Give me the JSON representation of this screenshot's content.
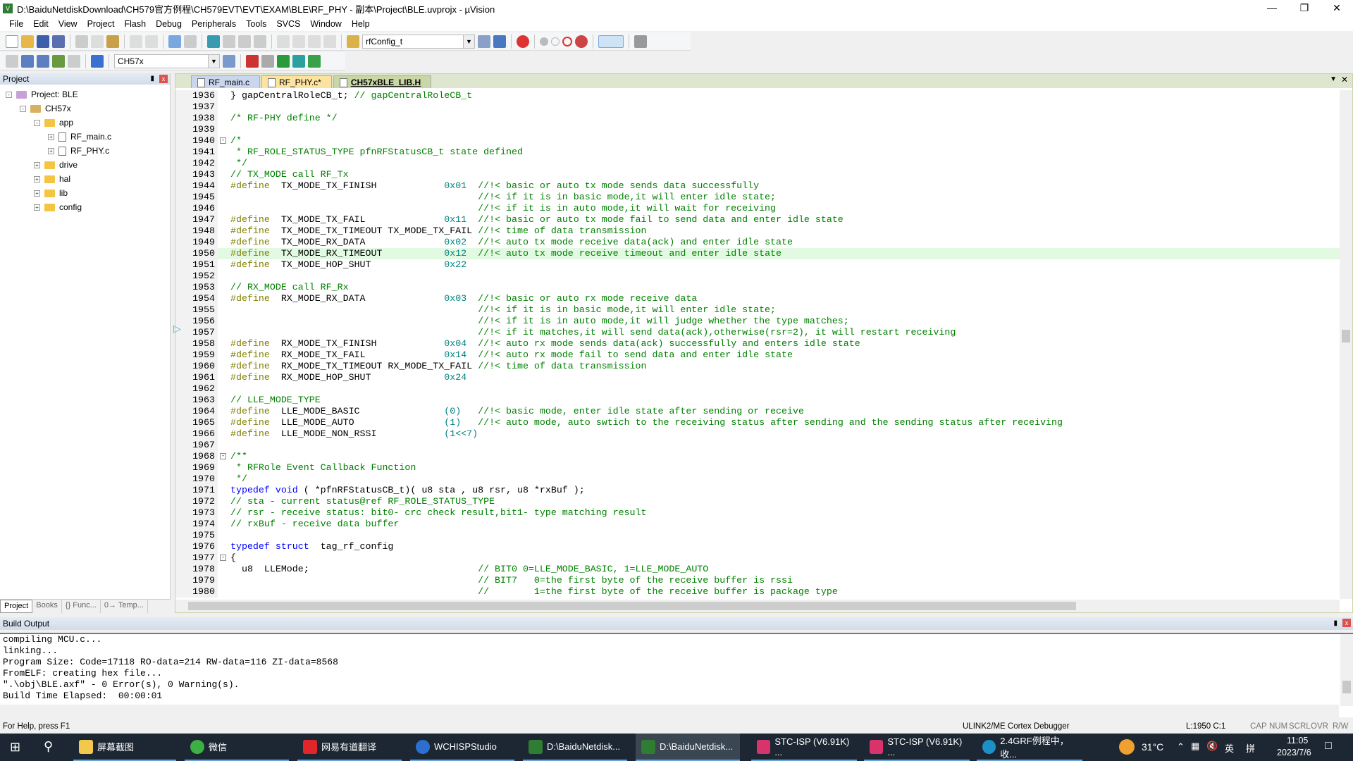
{
  "window": {
    "title": "D:\\BaiduNetdiskDownload\\CH579官方例程\\CH579EVT\\EVT\\EXAM\\BLE\\RF_PHY - 副本\\Project\\BLE.uvprojx - µVision",
    "app_icon": "V"
  },
  "menu": [
    "File",
    "Edit",
    "View",
    "Project",
    "Flash",
    "Debug",
    "Peripherals",
    "Tools",
    "SVCS",
    "Window",
    "Help"
  ],
  "toolbar": {
    "find_combo": "rfConfig_t",
    "target_combo": "CH57x"
  },
  "project_panel": {
    "title": "Project",
    "tree": [
      "Project: BLE",
      "CH57x",
      "app",
      "RF_main.c",
      "RF_PHY.c",
      "drive",
      "hal",
      "lib",
      "config"
    ],
    "tabs": [
      "Project",
      "Books",
      "{} Func...",
      "0→ Temp..."
    ]
  },
  "editor": {
    "tabs": [
      "RF_main.c",
      "RF_PHY.c*",
      "CH57xBLE_LIB.H"
    ],
    "active_tab": 2,
    "current_line": 1950,
    "lines": [
      {
        "n": 1936,
        "s": [
          [
            "t",
            "} gapCentralRoleCB_t; "
          ],
          [
            "c",
            "// gapCentralRoleCB_t"
          ]
        ]
      },
      {
        "n": 1937,
        "s": []
      },
      {
        "n": 1938,
        "s": [
          [
            "c",
            "/* RF-PHY define */"
          ]
        ]
      },
      {
        "n": 1939,
        "s": []
      },
      {
        "n": 1940,
        "f": true,
        "s": [
          [
            "c",
            "/*"
          ]
        ]
      },
      {
        "n": 1941,
        "s": [
          [
            "c",
            " * RF_ROLE_STATUS_TYPE pfnRFStatusCB_t state defined"
          ]
        ]
      },
      {
        "n": 1942,
        "s": [
          [
            "c",
            " */"
          ]
        ]
      },
      {
        "n": 1943,
        "s": [
          [
            "c",
            "// TX_MODE call RF_Tx"
          ]
        ]
      },
      {
        "n": 1944,
        "s": [
          [
            "p",
            "#define"
          ],
          [
            "t",
            "  TX_MODE_TX_FINISH            "
          ],
          [
            "n",
            "0x01"
          ],
          [
            "t",
            "  "
          ],
          [
            "c",
            "//!< basic or auto tx mode sends data successfully"
          ]
        ]
      },
      {
        "n": 1945,
        "s": [
          [
            "t",
            "                                            "
          ],
          [
            "c",
            "//!< if it is in basic mode,it will enter idle state;"
          ]
        ]
      },
      {
        "n": 1946,
        "s": [
          [
            "t",
            "                                            "
          ],
          [
            "c",
            "//!< if it is in auto mode,it will wait for receiving"
          ]
        ]
      },
      {
        "n": 1947,
        "s": [
          [
            "p",
            "#define"
          ],
          [
            "t",
            "  TX_MODE_TX_FAIL              "
          ],
          [
            "n",
            "0x11"
          ],
          [
            "t",
            "  "
          ],
          [
            "c",
            "//!< basic or auto tx mode fail to send data and enter idle state"
          ]
        ]
      },
      {
        "n": 1948,
        "s": [
          [
            "p",
            "#define"
          ],
          [
            "t",
            "  TX_MODE_TX_TIMEOUT TX_MODE_TX_FAIL "
          ],
          [
            "c",
            "//!< time of data transmission"
          ]
        ]
      },
      {
        "n": 1949,
        "s": [
          [
            "p",
            "#define"
          ],
          [
            "t",
            "  TX_MODE_RX_DATA              "
          ],
          [
            "n",
            "0x02"
          ],
          [
            "t",
            "  "
          ],
          [
            "c",
            "//!< auto tx mode receive data(ack) and enter idle state"
          ]
        ]
      },
      {
        "n": 1950,
        "s": [
          [
            "p",
            "#define"
          ],
          [
            "t",
            "  TX_MODE_RX_TIMEOUT           "
          ],
          [
            "n",
            "0x12"
          ],
          [
            "t",
            "  "
          ],
          [
            "c",
            "//!< auto tx mode receive timeout and enter idle state"
          ]
        ]
      },
      {
        "n": 1951,
        "s": [
          [
            "p",
            "#define"
          ],
          [
            "t",
            "  TX_MODE_HOP_SHUT             "
          ],
          [
            "n",
            "0x22"
          ]
        ]
      },
      {
        "n": 1952,
        "s": []
      },
      {
        "n": 1953,
        "s": [
          [
            "c",
            "// RX_MODE call RF_Rx"
          ]
        ]
      },
      {
        "n": 1954,
        "s": [
          [
            "p",
            "#define"
          ],
          [
            "t",
            "  RX_MODE_RX_DATA              "
          ],
          [
            "n",
            "0x03"
          ],
          [
            "t",
            "  "
          ],
          [
            "c",
            "//!< basic or auto rx mode receive data"
          ]
        ]
      },
      {
        "n": 1955,
        "s": [
          [
            "t",
            "                                            "
          ],
          [
            "c",
            "//!< if it is in basic mode,it will enter idle state;"
          ]
        ]
      },
      {
        "n": 1956,
        "s": [
          [
            "t",
            "                                            "
          ],
          [
            "c",
            "//!< if it is in auto mode,it will judge whether the type matches;"
          ]
        ]
      },
      {
        "n": 1957,
        "s": [
          [
            "t",
            "                                            "
          ],
          [
            "c",
            "//!< if it matches,it will send data(ack),otherwise(rsr=2), it will restart receiving"
          ]
        ]
      },
      {
        "n": 1958,
        "s": [
          [
            "p",
            "#define"
          ],
          [
            "t",
            "  RX_MODE_TX_FINISH            "
          ],
          [
            "n",
            "0x04"
          ],
          [
            "t",
            "  "
          ],
          [
            "c",
            "//!< auto rx mode sends data(ack) successfully and enters idle state"
          ]
        ]
      },
      {
        "n": 1959,
        "s": [
          [
            "p",
            "#define"
          ],
          [
            "t",
            "  RX_MODE_TX_FAIL              "
          ],
          [
            "n",
            "0x14"
          ],
          [
            "t",
            "  "
          ],
          [
            "c",
            "//!< auto rx mode fail to send data and enter idle state"
          ]
        ]
      },
      {
        "n": 1960,
        "s": [
          [
            "p",
            "#define"
          ],
          [
            "t",
            "  RX_MODE_TX_TIMEOUT RX_MODE_TX_FAIL "
          ],
          [
            "c",
            "//!< time of data transmission"
          ]
        ]
      },
      {
        "n": 1961,
        "s": [
          [
            "p",
            "#define"
          ],
          [
            "t",
            "  RX_MODE_HOP_SHUT             "
          ],
          [
            "n",
            "0x24"
          ]
        ]
      },
      {
        "n": 1962,
        "s": []
      },
      {
        "n": 1963,
        "s": [
          [
            "c",
            "// LLE_MODE_TYPE"
          ]
        ]
      },
      {
        "n": 1964,
        "s": [
          [
            "p",
            "#define"
          ],
          [
            "t",
            "  LLE_MODE_BASIC               "
          ],
          [
            "n",
            "(0)"
          ],
          [
            "t",
            "   "
          ],
          [
            "c",
            "//!< basic mode, enter idle state after sending or receive"
          ]
        ]
      },
      {
        "n": 1965,
        "s": [
          [
            "p",
            "#define"
          ],
          [
            "t",
            "  LLE_MODE_AUTO                "
          ],
          [
            "n",
            "(1)"
          ],
          [
            "t",
            "   "
          ],
          [
            "c",
            "//!< auto mode, auto swtich to the receiving status after sending and the sending status after receiving"
          ]
        ]
      },
      {
        "n": 1966,
        "s": [
          [
            "p",
            "#define"
          ],
          [
            "t",
            "  LLE_MODE_NON_RSSI            "
          ],
          [
            "n",
            "(1<<7)"
          ]
        ]
      },
      {
        "n": 1967,
        "s": []
      },
      {
        "n": 1968,
        "f": true,
        "s": [
          [
            "c",
            "/**"
          ]
        ]
      },
      {
        "n": 1969,
        "s": [
          [
            "c",
            " * RFRole Event Callback Function"
          ]
        ]
      },
      {
        "n": 1970,
        "s": [
          [
            "c",
            " */"
          ]
        ]
      },
      {
        "n": 1971,
        "s": [
          [
            "k",
            "typedef void"
          ],
          [
            "t",
            " ( *pfnRFStatusCB_t)( u8 sta , u8 rsr, u8 *rxBuf );"
          ]
        ]
      },
      {
        "n": 1972,
        "s": [
          [
            "c",
            "// sta - current status@ref RF_ROLE_STATUS_TYPE"
          ]
        ]
      },
      {
        "n": 1973,
        "s": [
          [
            "c",
            "// rsr - receive status: bit0- crc check result,bit1- type matching result"
          ]
        ]
      },
      {
        "n": 1974,
        "s": [
          [
            "c",
            "// rxBuf - receive data buffer"
          ]
        ]
      },
      {
        "n": 1975,
        "s": []
      },
      {
        "n": 1976,
        "s": [
          [
            "k",
            "typedef struct"
          ],
          [
            "t",
            "  tag_rf_config"
          ]
        ]
      },
      {
        "n": 1977,
        "f": true,
        "s": [
          [
            "t",
            "{"
          ]
        ]
      },
      {
        "n": 1978,
        "s": [
          [
            "t",
            "  u8  LLEMode;                              "
          ],
          [
            "c",
            "// BIT0 0=LLE_MODE_BASIC, 1=LLE_MODE_AUTO"
          ]
        ]
      },
      {
        "n": 1979,
        "s": [
          [
            "t",
            "                                            "
          ],
          [
            "c",
            "// BIT7   0=the first byte of the receive buffer is rssi"
          ]
        ]
      },
      {
        "n": 1980,
        "s": [
          [
            "t",
            "                                            "
          ],
          [
            "c",
            "//        1=the first byte of the receive buffer is package type"
          ]
        ]
      }
    ]
  },
  "build_output": {
    "title": "Build Output",
    "lines": [
      "compiling MCU.c...",
      "linking...",
      "Program Size: Code=17118 RO-data=214 RW-data=116 ZI-data=8568",
      "FromELF: creating hex file...",
      "\".\\obj\\BLE.axf\" - 0 Error(s), 0 Warning(s).",
      "Build Time Elapsed:  00:00:01"
    ]
  },
  "status": {
    "help": "For Help, press F1",
    "debugger": "ULINK2/ME Cortex Debugger",
    "position": "L:1950 C:1",
    "flags": [
      "CAP",
      "NUM",
      "SCRL",
      "OVR",
      "R/W"
    ]
  },
  "taskbar": {
    "items": [
      "屏幕截图",
      "微信",
      "网易有道翻译",
      "WCHISPStudio",
      "D:\\BaiduNetdisk...",
      "D:\\BaiduNetdisk...",
      "STC-ISP (V6.91K) ...",
      "STC-ISP (V6.91K) ...",
      "2.4GRF例程中，收..."
    ],
    "weather": "31°C",
    "ime": "英",
    "ime2": "拼",
    "time": "11:05",
    "date": "2023/7/6"
  }
}
